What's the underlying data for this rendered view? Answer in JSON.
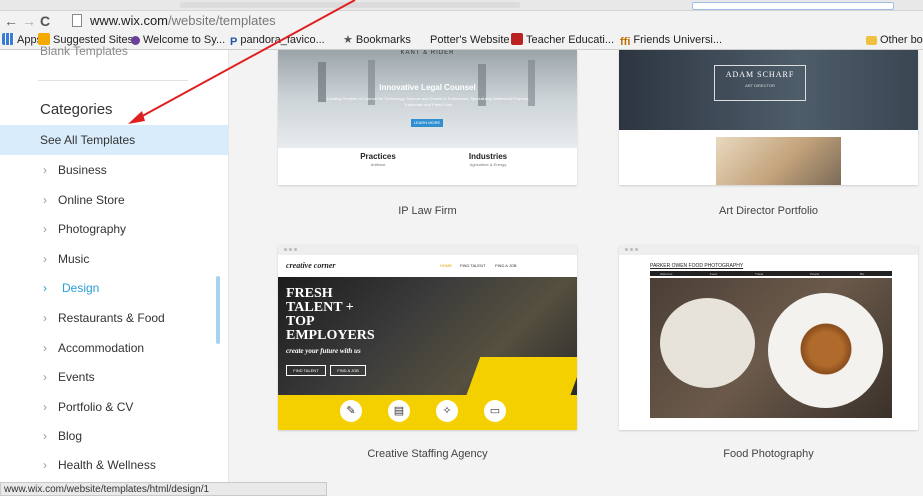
{
  "browser": {
    "url_host": "www.wix.com",
    "url_path": "/website/templates",
    "bookmarks": [
      "Apps",
      "Suggested Sites",
      "Welcome to Sy...",
      "pandora_favico...",
      "Bookmarks",
      "Potter's Website",
      "Teacher Educati...",
      "Friends Universi...",
      "Other bo"
    ]
  },
  "sidebar": {
    "blank_templates": "Blank Templates",
    "categories_heading": "Categories",
    "items": [
      {
        "label": "See All Templates"
      },
      {
        "label": "Business"
      },
      {
        "label": "Online Store"
      },
      {
        "label": "Photography"
      },
      {
        "label": "Music"
      },
      {
        "label": "Design"
      },
      {
        "label": "Restaurants & Food"
      },
      {
        "label": "Accommodation"
      },
      {
        "label": "Events"
      },
      {
        "label": "Portfolio & CV"
      },
      {
        "label": "Blog"
      },
      {
        "label": "Health & Wellness"
      }
    ]
  },
  "templates": [
    {
      "title": "IP Law Firm",
      "brand": "KANT & RIDER",
      "headline": "Innovative Legal Counsel",
      "tagline": "Leading Provider of Counsel for Technology, Science and Growth in Enterprises. Specializing Intellectual Property, Trademark and Patent Law",
      "cta": "LEARN MORE",
      "col1": "Practices",
      "col1_sub": "Antitrust",
      "col2": "Industries",
      "col2_sub": "Agriculture & Energy"
    },
    {
      "title": "Art Director Portfolio",
      "name": "ADAM SCHARF",
      "role": "ART DIRECTOR"
    },
    {
      "title": "Creative Staffing Agency",
      "logo": "creative corner",
      "nav": [
        "HOME",
        "FIND TALENT",
        "FIND A JOB"
      ],
      "headline_lines": [
        "FRESH",
        "TALENT +",
        "TOP",
        "EMPLOYERS"
      ],
      "sub": "create your future with us",
      "btn1": "FIND TALENT",
      "btn2": "FIND A JOB"
    },
    {
      "title": "Food Photography",
      "header": "PARKER OWEN FOOD PHOTOGRAPHY",
      "nav": [
        "Welcome",
        "Food",
        "Travel",
        "People",
        "Bio"
      ]
    }
  ],
  "status_url": "www.wix.com/website/templates/html/design/1",
  "colors": {
    "accent": "#2b9ed8",
    "selected_bg": "#d8ecfb",
    "annotation_arrow": "#e02020",
    "staffing_yellow": "#f5d000"
  }
}
